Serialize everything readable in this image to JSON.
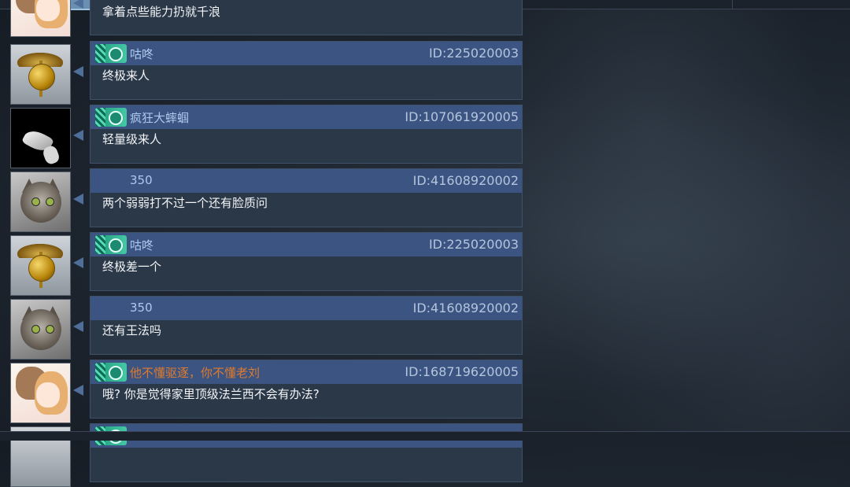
{
  "messages": [
    {
      "sender": "",
      "sender_color": "",
      "id": "",
      "text": "拿着点些能力扔就千浪",
      "avatar": "anime-couple",
      "badge": false
    },
    {
      "sender": "咕咚",
      "sender_color": "#aec8ef",
      "id": "ID:225020003",
      "text": "终极来人",
      "avatar": "marine-emblem",
      "badge": true
    },
    {
      "sender": "疯狂大蟀蝈",
      "sender_color": "#aec8ef",
      "id": "ID:107061920005",
      "text": "轻量级来人",
      "avatar": "dark-mask",
      "badge": true
    },
    {
      "sender": "350",
      "sender_color": "#aec8ef",
      "id": "ID:41608920002",
      "text": "两个弱弱打不过一个还有脸质问",
      "avatar": "cat",
      "badge": false
    },
    {
      "sender": "咕咚",
      "sender_color": "#aec8ef",
      "id": "ID:225020003",
      "text": "终极差一个",
      "avatar": "marine-emblem",
      "badge": true
    },
    {
      "sender": "350",
      "sender_color": "#aec8ef",
      "id": "ID:41608920002",
      "text": "还有王法吗",
      "avatar": "cat",
      "badge": false
    },
    {
      "sender": "他不懂驱逐，你不懂老刘",
      "sender_color": "#e07a2c",
      "id": "ID:168719620005",
      "text": "哦? 你是觉得家里顶级法兰西不会有办法?",
      "avatar": "anime-couple",
      "badge": true
    }
  ],
  "colors": {
    "bubble_header": "#3b5482",
    "bubble_body": "#2b3848",
    "message_text": "#f2f4f7",
    "id_text": "#b5c6dc",
    "highlight_sender": "#e07a2c"
  }
}
